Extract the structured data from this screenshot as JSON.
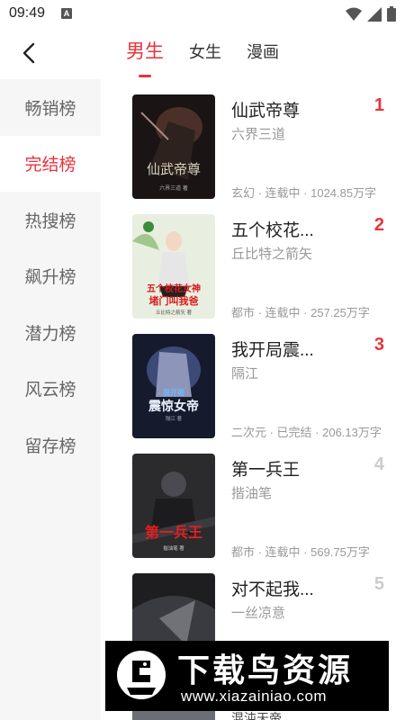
{
  "status": {
    "time": "09:49"
  },
  "tabs": [
    {
      "label": "男生",
      "active": true
    },
    {
      "label": "女生",
      "active": false
    },
    {
      "label": "漫画",
      "active": false
    }
  ],
  "sidebar": [
    {
      "label": "畅销榜",
      "active": false
    },
    {
      "label": "完结榜",
      "active": true
    },
    {
      "label": "热搜榜",
      "active": false
    },
    {
      "label": "飙升榜",
      "active": false
    },
    {
      "label": "潜力榜",
      "active": false
    },
    {
      "label": "风云榜",
      "active": false
    },
    {
      "label": "留存榜",
      "active": false
    }
  ],
  "books": [
    {
      "rank": "1",
      "title": "仙武帝尊",
      "author": "六界三道",
      "meta": "玄幻 · 连载中 · 1024.85万字",
      "cover_text": "仙武帝尊",
      "cover_sub": "六界三道 著"
    },
    {
      "rank": "2",
      "title": "五个校花...",
      "author": "丘比特之箭矢",
      "meta": "都市 · 连载中 · 257.25万字",
      "cover_text": "五个校花女神",
      "cover_text2": "堵门叫我爸",
      "cover_sub": "丘比特之箭矢 著"
    },
    {
      "rank": "3",
      "title": "我开局震...",
      "author": "隔江",
      "meta": "二次元 · 已完结 · 206.13万字",
      "cover_text": "我开局",
      "cover_text2": "震惊女帝",
      "cover_sub": "隔江 著"
    },
    {
      "rank": "4",
      "title": "第一兵王",
      "author": "揩油笔",
      "meta": "都市 · 连载中 · 569.75万字",
      "cover_text": "第一兵王",
      "cover_sub": "揩油笔 著"
    },
    {
      "rank": "5",
      "title": "对不起我...",
      "author": "一丝凉意",
      "meta": "",
      "cover_text": "",
      "cover_sub": ""
    }
  ],
  "peek": {
    "title": "混沌天帝"
  },
  "watermark": {
    "title": "下载鸟资源",
    "url": "www.xiazainiao.com"
  },
  "colors": {
    "accent": "#e8333b",
    "muted": "#999999",
    "sidebar_bg": "#f6f6f6"
  }
}
